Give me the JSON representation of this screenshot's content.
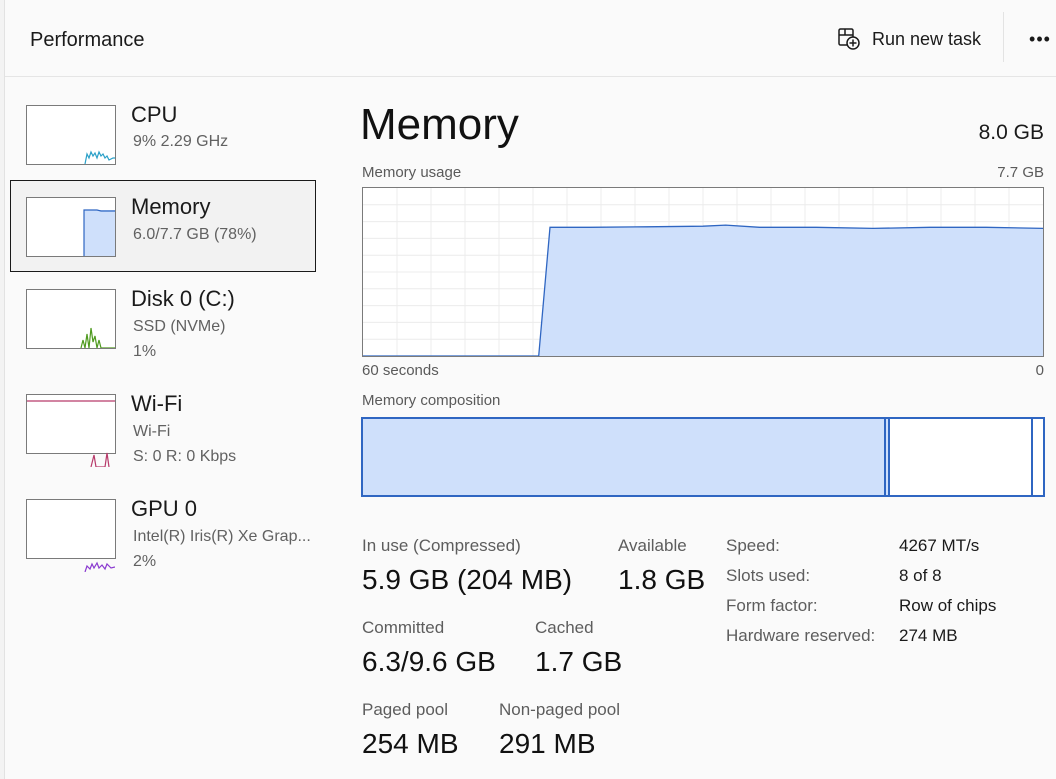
{
  "header": {
    "title": "Performance",
    "run_task_label": "Run new task",
    "more_label": "•••"
  },
  "sidebar": {
    "items": [
      {
        "name": "CPU",
        "sub1": "9%  2.29 GHz",
        "sub2": ""
      },
      {
        "name": "Memory",
        "sub1": "6.0/7.7 GB (78%)",
        "sub2": ""
      },
      {
        "name": "Disk 0 (C:)",
        "sub1": "SSD (NVMe)",
        "sub2": "1%"
      },
      {
        "name": "Wi-Fi",
        "sub1": "Wi-Fi",
        "sub2": "S: 0  R: 0 Kbps"
      },
      {
        "name": "GPU 0",
        "sub1": "Intel(R) Iris(R) Xe Grap...",
        "sub2": "2%"
      }
    ]
  },
  "main": {
    "title": "Memory",
    "total": "8.0 GB",
    "usage_label": "Memory usage",
    "usage_max": "7.7 GB",
    "axis_left": "60 seconds",
    "axis_right": "0",
    "composition_label": "Memory composition",
    "composition": {
      "in_use_fraction": 0.77,
      "modified_fraction": 0.005,
      "standby_fraction": 0.21,
      "free_fraction": 0.015
    },
    "stats": {
      "in_use_label": "In use (Compressed)",
      "in_use_value": "5.9 GB (204 MB)",
      "available_label": "Available",
      "available_value": "1.8 GB",
      "committed_label": "Committed",
      "committed_value": "6.3/9.6 GB",
      "cached_label": "Cached",
      "cached_value": "1.7 GB",
      "paged_label": "Paged pool",
      "paged_value": "254 MB",
      "nonpaged_label": "Non-paged pool",
      "nonpaged_value": "291 MB"
    },
    "details": [
      {
        "key": "Speed:",
        "value": "4267 MT/s"
      },
      {
        "key": "Slots used:",
        "value": "8 of 8"
      },
      {
        "key": "Form factor:",
        "value": "Row of chips"
      },
      {
        "key": "Hardware reserved:",
        "value": "274 MB"
      }
    ]
  },
  "colors": {
    "memory_fill": "#cfe0fb",
    "memory_line": "#2f66c2",
    "cpu_line": "#2aa0c8",
    "disk_line": "#4f9a1f",
    "wifi_line": "#b83a6a",
    "gpu_line": "#8a3ad0"
  },
  "chart_data": {
    "type": "area",
    "ylabel": "Memory usage",
    "ylim": [
      0,
      7.7
    ],
    "x_range_seconds": [
      60,
      0
    ],
    "series": [
      {
        "x": [
          60,
          44.5,
          43.5,
          40,
          35,
          30,
          28,
          25,
          20,
          15,
          10,
          5,
          0
        ],
        "values": [
          0,
          0,
          5.9,
          5.9,
          5.92,
          5.95,
          6.0,
          5.9,
          5.9,
          5.85,
          5.9,
          5.9,
          5.85
        ]
      }
    ]
  }
}
